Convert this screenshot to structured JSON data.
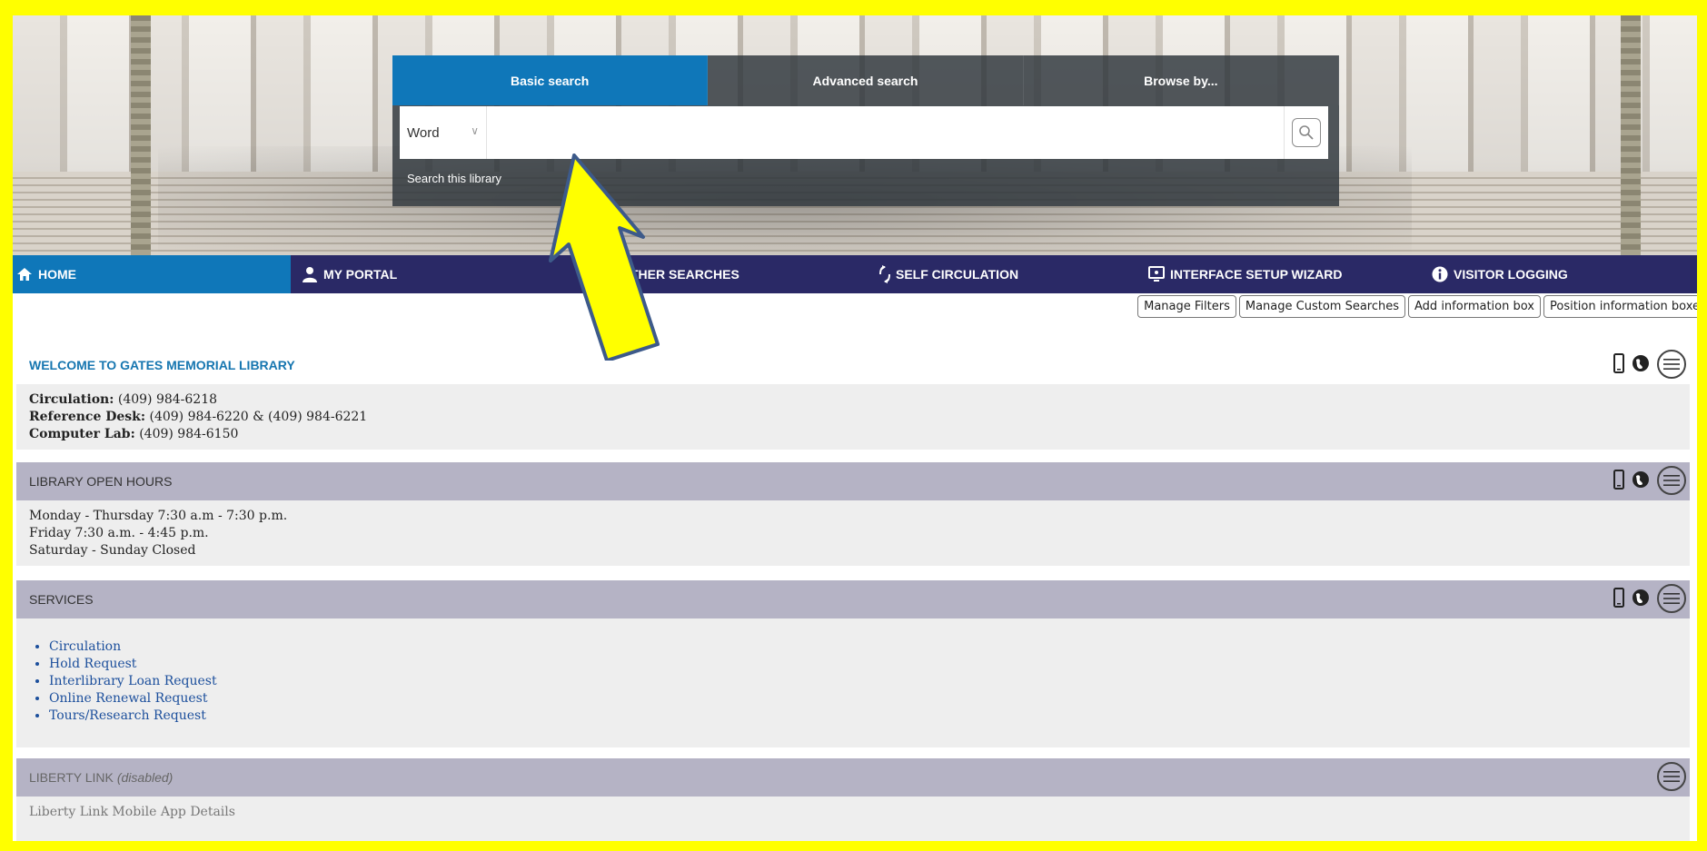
{
  "search": {
    "tabs": [
      "Basic search",
      "Advanced search",
      "Browse by..."
    ],
    "search_type": "Word",
    "input_value": "",
    "caption": "Search this library"
  },
  "nav": {
    "items": [
      {
        "label": "HOME",
        "icon": "home-icon"
      },
      {
        "label": "MY PORTAL",
        "icon": "user-icon"
      },
      {
        "label": "THER SEARCHES",
        "icon": ""
      },
      {
        "label": "SELF CIRCULATION",
        "icon": "refresh-icon"
      },
      {
        "label": "INTERFACE SETUP WIZARD",
        "icon": "monitor-icon"
      },
      {
        "label": "VISITOR LOGGING",
        "icon": "info-icon"
      }
    ]
  },
  "toolbar": {
    "buttons": [
      "Manage Filters",
      "Manage Custom Searches",
      "Add information box",
      "Position information boxe"
    ]
  },
  "boxes": {
    "welcome": {
      "title": "WELCOME TO GATES MEMORIAL LIBRARY",
      "lines": [
        {
          "label": "Circulation:",
          "value": " (409) 984-6218"
        },
        {
          "label": "Reference Desk:",
          "value": " (409) 984-6220 & (409) 984-6221"
        },
        {
          "label": "Computer Lab:",
          "value": " (409) 984-6150"
        }
      ]
    },
    "hours": {
      "title": "LIBRARY OPEN HOURS",
      "lines": [
        "Monday - Thursday 7:30 a.m - 7:30 p.m.",
        "Friday 7:30 a.m. - 4:45 p.m.",
        "Saturday - Sunday Closed"
      ]
    },
    "services": {
      "title": "SERVICES",
      "links": [
        "Circulation",
        "Hold Request",
        "Interlibrary Loan Request",
        "Online Renewal Request",
        "Tours/Research Request"
      ]
    },
    "liberty": {
      "title": "LIBERTY LINK",
      "status": "(disabled)",
      "line1": "Liberty Link Mobile App Details"
    }
  },
  "colors": {
    "frame": "#ffff00",
    "nav_bg": "#2a2966",
    "accent": "#0f77b9",
    "box_header": "#b5b3c5",
    "arrow_fill": "#ffff00",
    "arrow_stroke": "#3d5a8a"
  }
}
